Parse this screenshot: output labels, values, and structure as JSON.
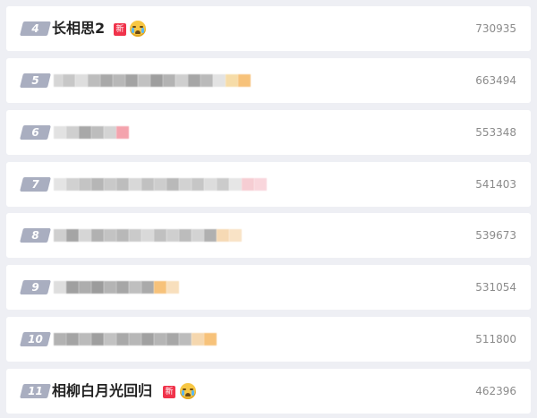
{
  "items": [
    {
      "rank": "4",
      "title": "长相思2",
      "new_badge": "新",
      "emoji": "crying-face-icon",
      "count": "730935"
    },
    {
      "rank": "5",
      "title": "",
      "count": "663494"
    },
    {
      "rank": "6",
      "title": "",
      "count": "553348"
    },
    {
      "rank": "7",
      "title": "",
      "count": "541403"
    },
    {
      "rank": "8",
      "title": "",
      "count": "539673"
    },
    {
      "rank": "9",
      "title": "",
      "count": "531054"
    },
    {
      "rank": "10",
      "title": "",
      "count": "511800"
    },
    {
      "rank": "11",
      "title": "相柳白月光回归",
      "new_badge": "新",
      "emoji": "crying-face-icon",
      "count": "462396"
    }
  ],
  "colors": {
    "rank_badge": "#a9aec0",
    "new_badge": "#f0334b",
    "count_text": "#8b8b8b",
    "background": "#eeeff4"
  }
}
